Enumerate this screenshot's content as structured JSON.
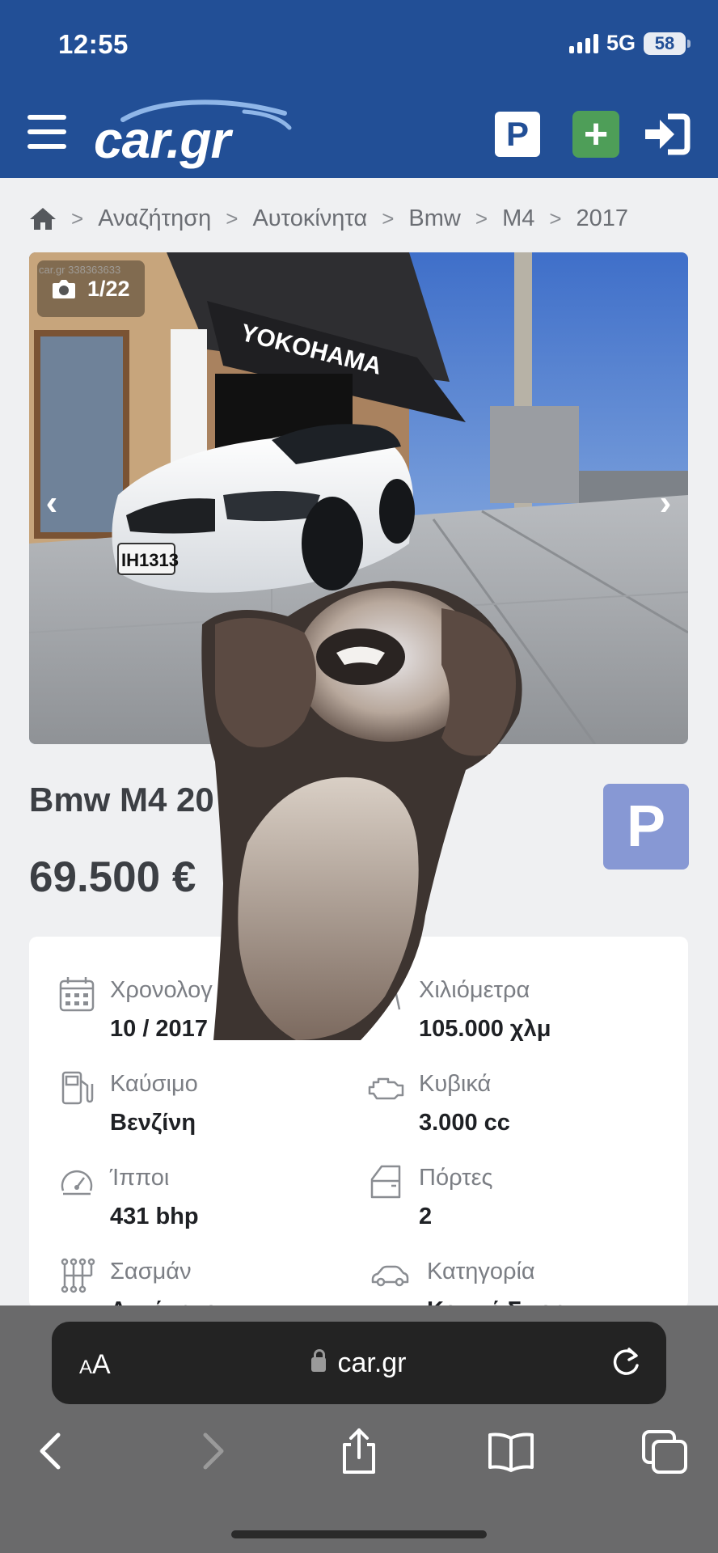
{
  "status_bar": {
    "time": "12:55",
    "network": "5G",
    "battery": "58"
  },
  "header": {
    "logo_text": "car.gr",
    "parking_label": "P",
    "add_label": "+"
  },
  "breadcrumb": [
    "Αναζήτηση",
    "Αυτοκίνητα",
    "Bmw",
    "M4",
    "2017"
  ],
  "gallery": {
    "counter": "1/22",
    "watermark": "car.gr 338363633",
    "sign_text": "YOKOHAMA",
    "plate": "IH1313"
  },
  "listing": {
    "title": "Bmw M4 20",
    "price": "69.500 €",
    "parking_label": "P"
  },
  "specs": [
    {
      "icon": "calendar-icon",
      "label": "Χρονολογ",
      "value": "10 / 2017"
    },
    {
      "icon": "road-icon",
      "label": "Χιλιόμετρα",
      "value": "105.000 χλμ"
    },
    {
      "icon": "fuel-pump-icon",
      "label": "Καύσιμο",
      "value": "Βενζίνη"
    },
    {
      "icon": "engine-icon",
      "label": "Κυβικά",
      "value": "3.000 cc"
    },
    {
      "icon": "speedometer-icon",
      "label": "Ίπποι",
      "value": "431 bhp"
    },
    {
      "icon": "car-door-icon",
      "label": "Πόρτες",
      "value": "2"
    },
    {
      "icon": "gearbox-icon",
      "label": "Σασμάν",
      "value": "Αυτόματο"
    },
    {
      "icon": "car-icon",
      "label": "Κατηγορία",
      "value": "Κουπέ-Σπορ"
    }
  ],
  "browser": {
    "text_size_label_small": "A",
    "text_size_label_large": "A",
    "url": "car.gr"
  },
  "colors": {
    "brand_blue": "#224f96",
    "add_green": "#4e9e58",
    "parking_light": "#8798d4"
  }
}
